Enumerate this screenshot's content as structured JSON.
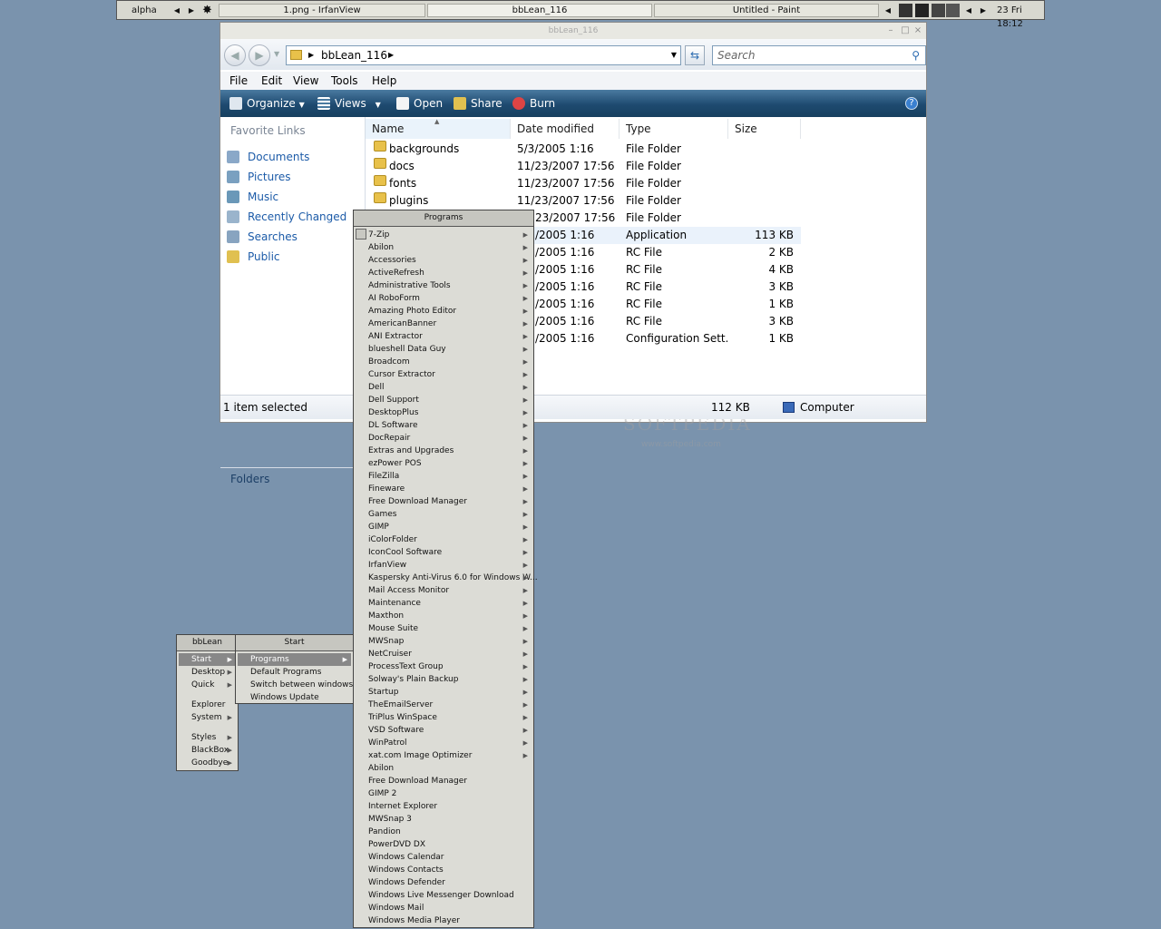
{
  "toolbar": {
    "workspace": "alpha",
    "tasks": [
      "1.png - IrfanView",
      "bbLean_116",
      "Untitled - Paint"
    ],
    "clock": "23 Fri 18:12"
  },
  "explorer": {
    "title": "bbLean_116",
    "address": "bbLean_116",
    "search_placeholder": "Search",
    "menu": [
      "File",
      "Edit",
      "View",
      "Tools",
      "Help"
    ],
    "commands": [
      "Organize",
      "Views",
      "Open",
      "Share",
      "Burn"
    ],
    "favorite_links_header": "Favorite Links",
    "favorites": [
      "Documents",
      "Pictures",
      "Music",
      "Recently Changed",
      "Searches",
      "Public"
    ],
    "folders_label": "Folders",
    "columns": [
      "Name",
      "Date modified",
      "Type",
      "Size"
    ],
    "rows": [
      {
        "name": "backgrounds",
        "date": "5/3/2005 1:16",
        "type": "File Folder",
        "size": ""
      },
      {
        "name": "docs",
        "date": "11/23/2007 17:56",
        "type": "File Folder",
        "size": ""
      },
      {
        "name": "fonts",
        "date": "11/23/2007 17:56",
        "type": "File Folder",
        "size": ""
      },
      {
        "name": "plugins",
        "date": "11/23/2007 17:56",
        "type": "File Folder",
        "size": ""
      },
      {
        "name": "",
        "date": "23/2007 17:56",
        "type": "File Folder",
        "size": ""
      },
      {
        "name": "",
        "date": "/2005 1:16",
        "type": "Application",
        "size": "113 KB"
      },
      {
        "name": "",
        "date": "/2005 1:16",
        "type": "RC File",
        "size": "2 KB"
      },
      {
        "name": "",
        "date": "/2005 1:16",
        "type": "RC File",
        "size": "4 KB"
      },
      {
        "name": "",
        "date": "/2005 1:16",
        "type": "RC File",
        "size": "3 KB"
      },
      {
        "name": "",
        "date": "/2005 1:16",
        "type": "RC File",
        "size": "1 KB"
      },
      {
        "name": "",
        "date": "/2005 1:16",
        "type": "RC File",
        "size": "3 KB"
      },
      {
        "name": "",
        "date": "/2005 1:16",
        "type": "Configuration Sett...",
        "size": "1 KB"
      }
    ],
    "status_left": "1 item selected",
    "status_size": "112 KB",
    "status_location": "Computer",
    "watermark": "SOFTPEDIA",
    "watermark_url": "www.softpedia.com"
  },
  "bb_menu": {
    "title": "bbLean",
    "items": [
      "Start",
      "Desktop",
      "Quick",
      "Explorer",
      "System",
      "Styles",
      "BlackBox",
      "Goodbye"
    ]
  },
  "start_menu": {
    "title": "Start",
    "items": [
      "Programs",
      "Default Programs",
      "Switch between windows",
      "Windows Update"
    ]
  },
  "programs_menu": {
    "title": "Programs",
    "folders": [
      "7-Zip",
      "Abilon",
      "Accessories",
      "ActiveRefresh",
      "Administrative Tools",
      "AI RoboForm",
      "Amazing Photo Editor",
      "AmericanBanner",
      "ANI Extractor",
      "blueshell Data Guy",
      "Broadcom",
      "Cursor Extractor",
      "Dell",
      "Dell Support",
      "DesktopPlus",
      "DL Software",
      "DocRepair",
      "Extras and Upgrades",
      "ezPower POS",
      "FileZilla",
      "Fineware",
      "Free Download Manager",
      "Games",
      "GIMP",
      "iColorFolder",
      "IconCool Software",
      "IrfanView",
      "Kaspersky Anti-Virus 6.0 for Windows W...",
      "Mail Access Monitor",
      "Maintenance",
      "Maxthon",
      "Mouse Suite",
      "MWSnap",
      "NetCruiser",
      "ProcessText Group",
      "Solway's Plain Backup",
      "Startup",
      "TheEmailServer",
      "TriPlus WinSpace",
      "VSD Software",
      "WinPatrol",
      "xat.com Image Optimizer"
    ],
    "shortcuts": [
      "Abilon",
      "Free Download Manager",
      "GIMP 2",
      "Internet Explorer",
      "MWSnap 3",
      "Pandion",
      "PowerDVD DX",
      "Windows Calendar",
      "Windows Contacts",
      "Windows Defender",
      "Windows Live Messenger Download",
      "Windows Mail",
      "Windows Media Player"
    ]
  }
}
